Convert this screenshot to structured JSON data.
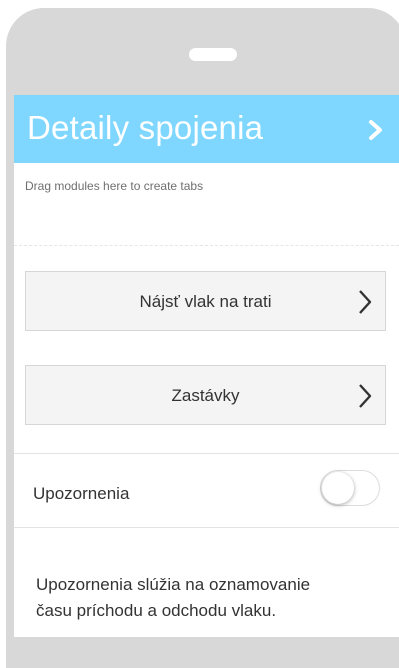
{
  "header": {
    "title": "Detaily spojenia",
    "arrow_icon": "chevron-right-icon",
    "color": "#7fd7ff"
  },
  "drag_hint": "Drag modules here to create tabs",
  "buttons": [
    {
      "label": "Nájsť vlak na trati",
      "icon": "chevron-right-icon"
    },
    {
      "label": "Zastávky",
      "icon": "chevron-right-icon"
    }
  ],
  "notifications": {
    "label": "Upozornenia",
    "toggle_on": false,
    "description_lines": [
      "Upozornenia slúžia na oznamovanie",
      "času príchodu a odchodu vlaku."
    ]
  }
}
